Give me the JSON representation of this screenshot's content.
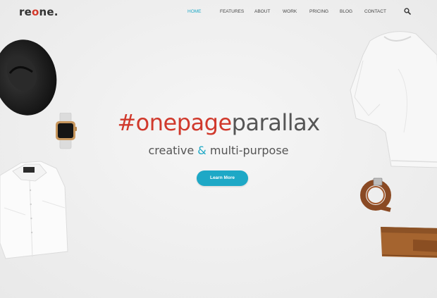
{
  "brand": {
    "logo_pre": "re",
    "logo_o": "o",
    "logo_post": "ne."
  },
  "nav": {
    "items": [
      {
        "label": "HOME",
        "active": true
      },
      {
        "label": "FEATURES"
      },
      {
        "label": "ABOUT"
      },
      {
        "label": "WORK"
      },
      {
        "label": "PRICING"
      },
      {
        "label": "BLOG"
      },
      {
        "label": "CONTACT"
      }
    ],
    "search_icon": "search-icon"
  },
  "hero": {
    "headline_red": "#onepage",
    "headline_dark": "parallax",
    "sub_pre": "creative ",
    "sub_amp": "&",
    "sub_post": " multi-purpose",
    "button": "Learn More"
  },
  "colors": {
    "accent": "#1ea8c6",
    "brand_red": "#d0392c",
    "text": "#555555"
  },
  "images": [
    "hat",
    "watch",
    "shirt",
    "sweater",
    "belt",
    "wallet"
  ]
}
